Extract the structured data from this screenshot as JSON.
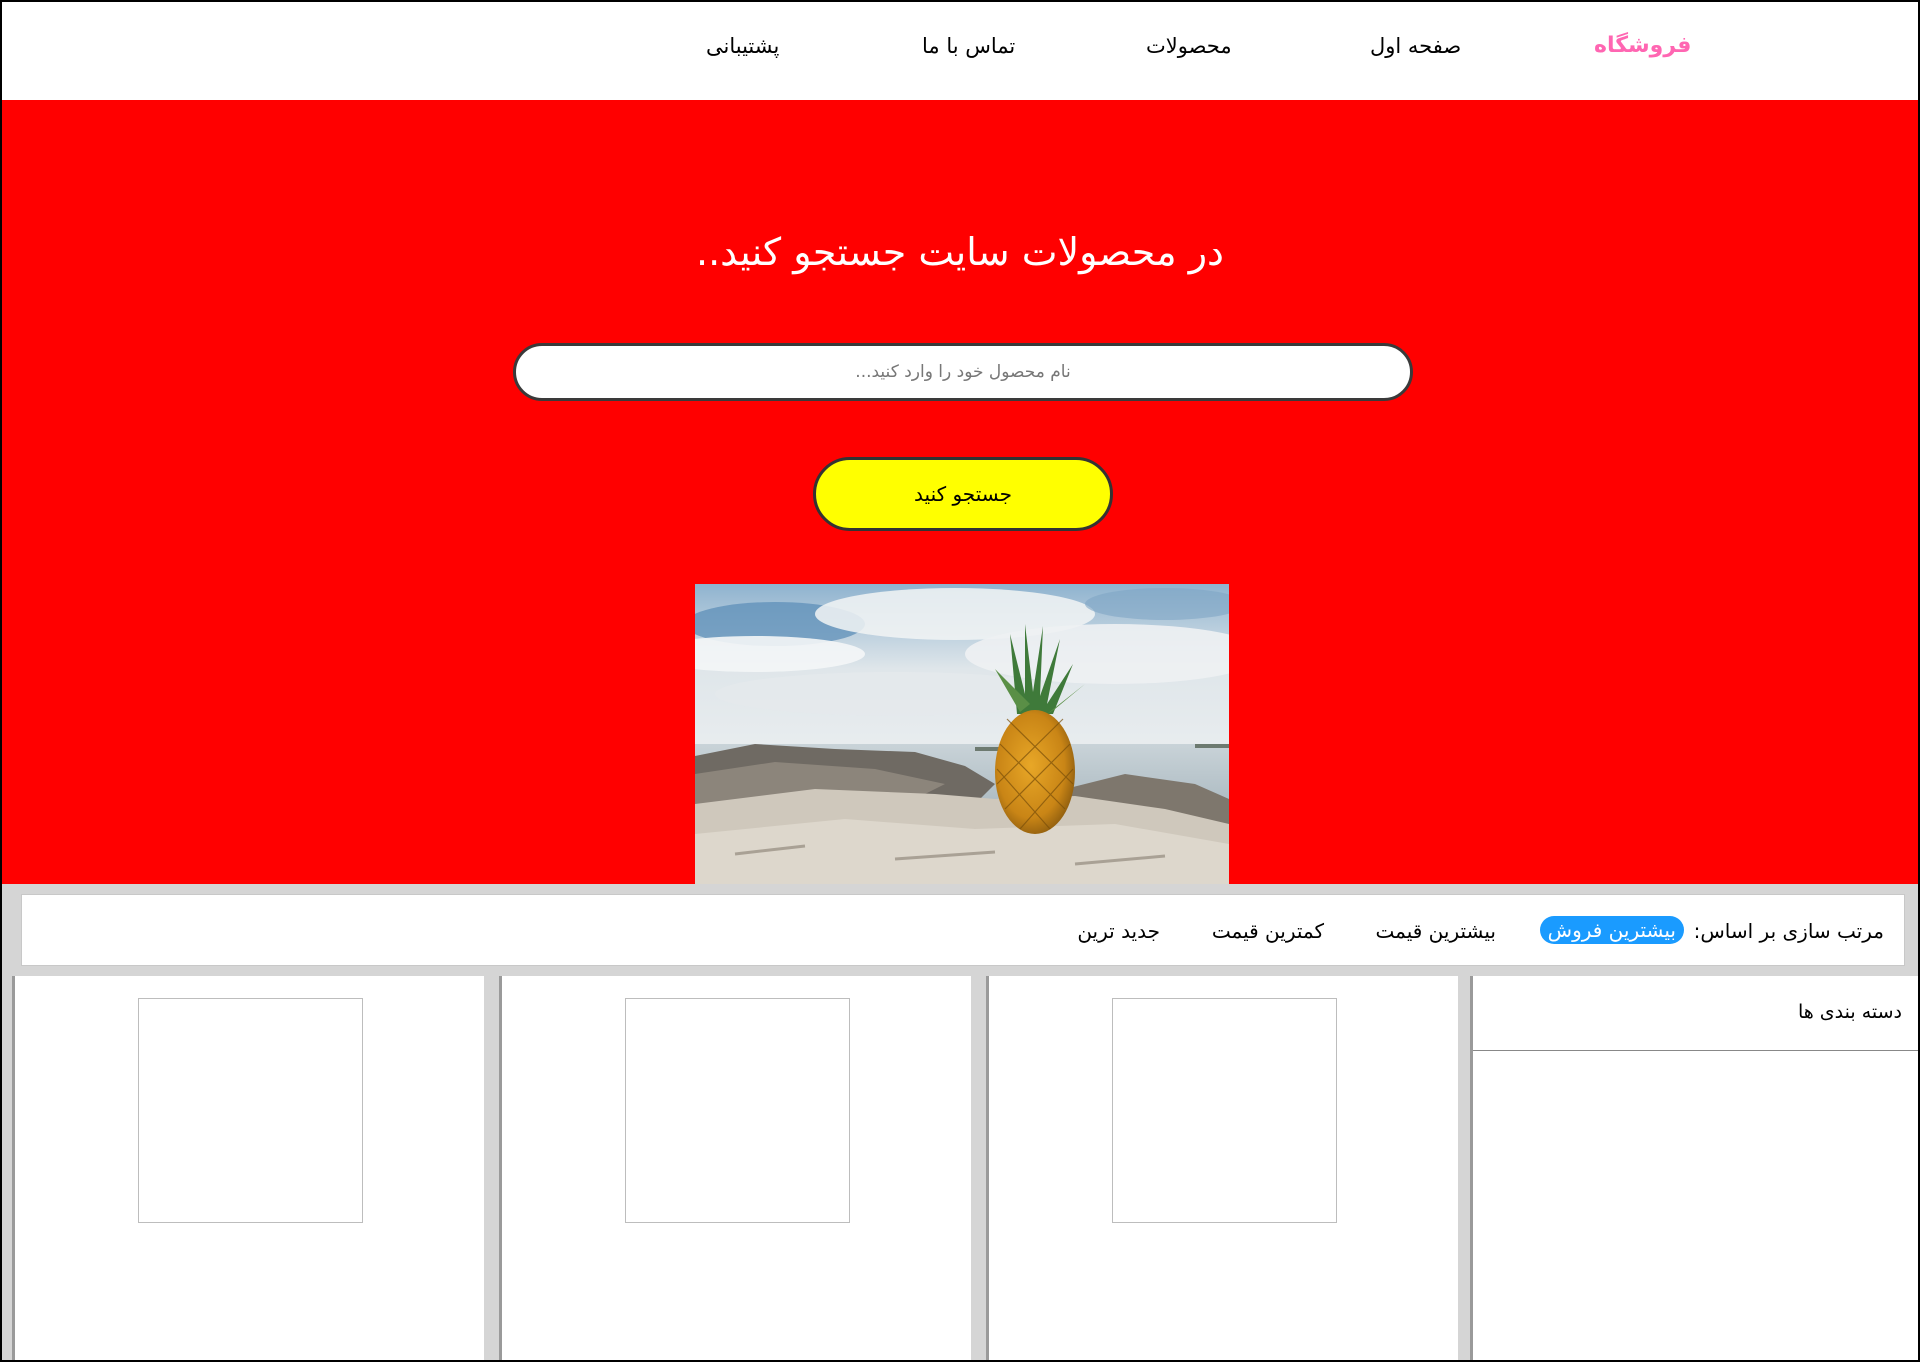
{
  "nav": {
    "brand": "فروشگاه",
    "items": [
      "صفحه اول",
      "محصولات",
      "تماس با ما",
      "پشتیبانی"
    ]
  },
  "hero": {
    "title": "در محصولات سایت جستجو کنید..",
    "search_placeholder": "نام محصول خود را وارد کنید...",
    "search_button": "جستجو  کنید"
  },
  "sort": {
    "label": "مرتب سازی بر اساس:",
    "options": [
      "بیشترین فروش",
      "بیشترین قیمت",
      "کمترین قیمت",
      "جدید ترین"
    ],
    "active": "بیشترین فروش"
  },
  "categories": {
    "title": "دسته بندی ها"
  },
  "colors": {
    "brand": "#ff66b2",
    "hero_bg": "#ff0000",
    "button_bg": "#ffff00",
    "active_sort": "#1a9bff"
  }
}
